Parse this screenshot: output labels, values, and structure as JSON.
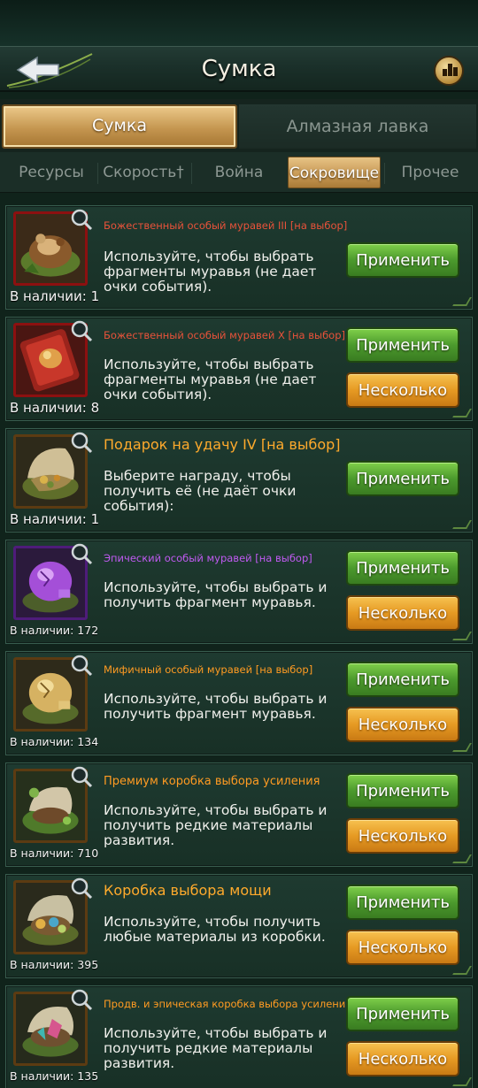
{
  "header": {
    "title": "Сумка"
  },
  "main_tabs": [
    {
      "label": "Сумка",
      "active": true
    },
    {
      "label": "Алмазная лавка",
      "active": false
    }
  ],
  "sub_tabs": [
    {
      "label": "Ресурсы",
      "active": false
    },
    {
      "label": "Скорость†",
      "active": false
    },
    {
      "label": "Война",
      "active": false
    },
    {
      "label": "Сокровище",
      "active": true
    },
    {
      "label": "Прочее",
      "active": false
    }
  ],
  "buttons": {
    "apply": "Применить",
    "multiple": "Несколько"
  },
  "items": [
    {
      "name": "Божественный особый муравей III [на выбор]",
      "description": "Используйте, чтобы выбрать фрагменты муравья (не дает очки события).",
      "quantity": "В наличии: 1",
      "frame_color": "red",
      "icon": "divine-ant-nest-icon",
      "buttons": [
        "apply"
      ]
    },
    {
      "name": "Божественный особый муравей X [на выбор]",
      "description": "Используйте, чтобы выбрать фрагменты муравья (не дает очки события).",
      "quantity": "В наличии: 8",
      "frame_color": "red",
      "icon": "divine-ant-book-icon",
      "buttons": [
        "apply",
        "multiple"
      ]
    },
    {
      "name": "Подарок на удачу IV [на выбор]",
      "description": "Выберите награду, чтобы получить её (не даёт очки события):",
      "quantity": "В наличии: 1",
      "frame_color": "gold",
      "icon": "lucky-gift-shell-icon",
      "buttons": [
        "apply"
      ]
    },
    {
      "name": "Эпический особый муравей [на выбор]",
      "description": "Используйте, чтобы выбрать и получить фрагмент муравья.",
      "quantity": "В наличии: 172",
      "frame_color": "purple",
      "icon": "epic-ant-egg-icon",
      "buttons": [
        "apply",
        "multiple"
      ]
    },
    {
      "name": "Мифичный особый муравей [на выбор]",
      "description": "Используйте, чтобы выбрать и получить фрагмент муравья.",
      "quantity": "В наличии: 134",
      "frame_color": "gold",
      "icon": "mythic-ant-egg-icon",
      "buttons": [
        "apply",
        "multiple"
      ]
    },
    {
      "name": "Премиум коробка выбора усиления",
      "description": "Используйте, чтобы выбрать и получить редкие материалы развития.",
      "quantity": "В наличии: 710",
      "frame_color": "gold",
      "icon": "premium-boost-box-icon",
      "buttons": [
        "apply",
        "multiple"
      ]
    },
    {
      "name": "Коробка выбора мощи",
      "description": "Используйте, чтобы получить любые материалы из коробки.",
      "quantity": "В наличии: 395",
      "frame_color": "gold",
      "icon": "power-choice-box-icon",
      "buttons": [
        "apply",
        "multiple"
      ]
    },
    {
      "name": "Продв. и эпическая коробка выбора усиления",
      "description": "Используйте, чтобы выбрать и получить редкие материалы развития.",
      "quantity": "В наличии: 135",
      "frame_color": "gold",
      "icon": "advanced-epic-boost-box-icon",
      "buttons": [
        "apply",
        "multiple"
      ]
    }
  ],
  "colors": {
    "background": "#10231b",
    "card": "#1e3a30",
    "green_button": "#4c9a2d",
    "orange_button": "#e69a23",
    "active_tab": "#c59650"
  }
}
